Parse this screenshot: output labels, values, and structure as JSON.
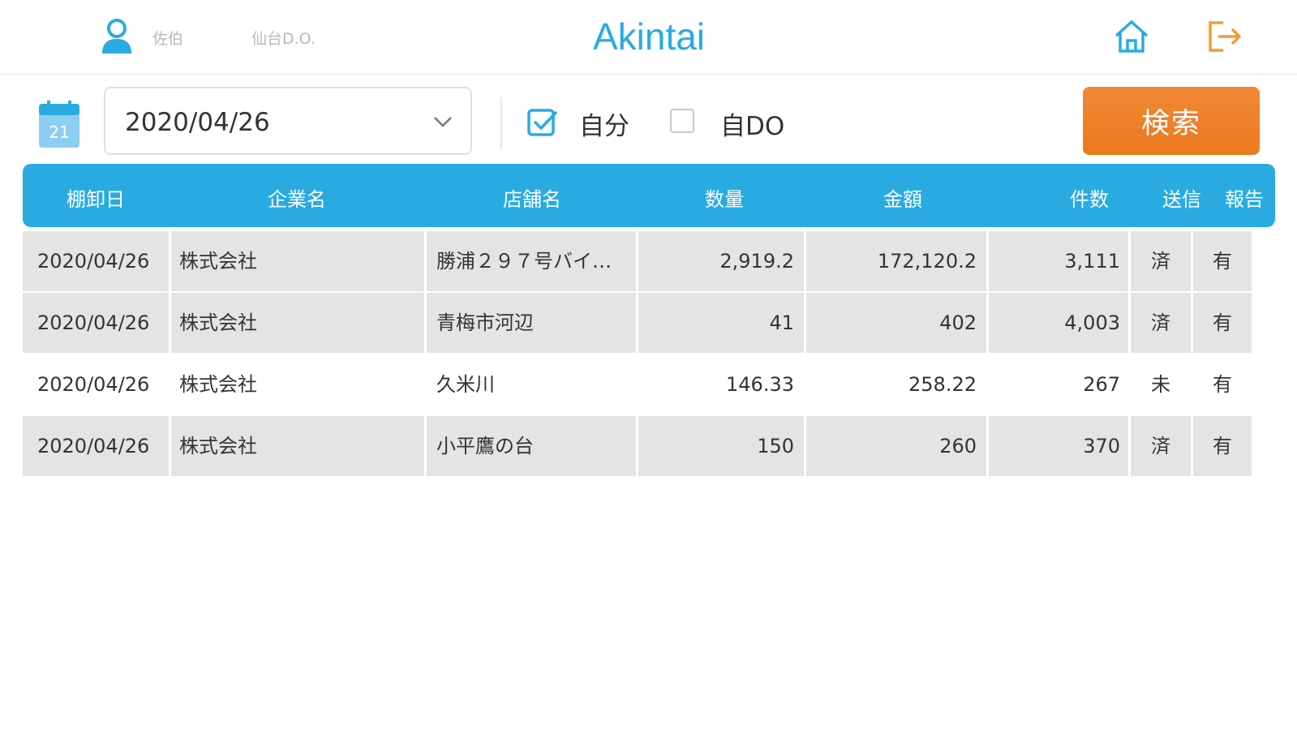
{
  "header": {
    "user_name": "佐伯",
    "org_name": "仙台D.O.",
    "app_title": "Akintai"
  },
  "toolbar": {
    "date_value": "2020/04/26",
    "checkbox_self_label": "自分",
    "checkbox_self_checked": true,
    "checkbox_do_label": "自DO",
    "checkbox_do_checked": false,
    "search_label": "検索"
  },
  "table": {
    "headers": [
      "棚卸日",
      "企業名",
      "店舗名",
      "数量",
      "金額",
      "件数",
      "送信",
      "報告"
    ],
    "rows": [
      [
        "2020/04/26",
        "株式会社",
        "勝浦２９７号バイ…",
        "2,919.2",
        "172,120.2",
        "3,111",
        "済",
        "有"
      ],
      [
        "2020/04/26",
        "株式会社",
        "青梅市河辺",
        "41",
        "402",
        "4,003",
        "済",
        "有"
      ],
      [
        "2020/04/26",
        "株式会社",
        "久米川",
        "146.33",
        "258.22",
        "267",
        "未",
        "有"
      ],
      [
        "2020/04/26",
        "株式会社",
        "小平鷹の台",
        "150",
        "260",
        "370",
        "済",
        "有"
      ]
    ]
  },
  "colors": {
    "accent": "#29abe2",
    "button": "#ef8227",
    "row_gray": "#e4e4e4",
    "logout_icon": "#f39c32"
  },
  "icons": {
    "user": "user-icon",
    "home": "home-icon",
    "logout": "logout-icon",
    "calendar": "calendar-icon",
    "dropdown": "chevron-down-icon"
  }
}
